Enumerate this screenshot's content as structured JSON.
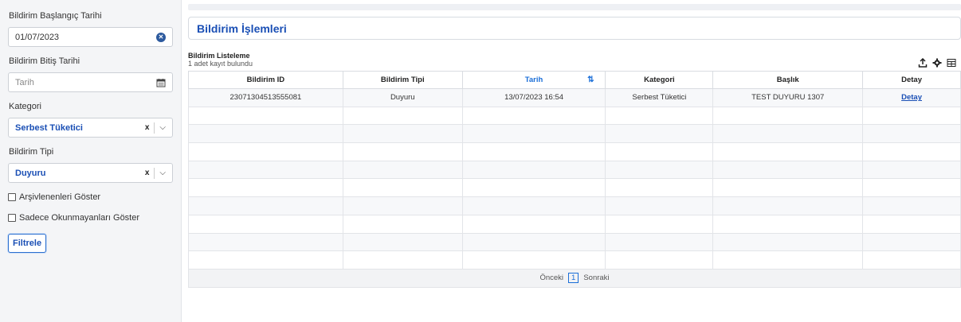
{
  "filters": {
    "start_date_label": "Bildirim Başlangıç Tarihi",
    "start_date_value": "01/07/2023",
    "end_date_label": "Bildirim Bitiş Tarihi",
    "end_date_placeholder": "Tarih",
    "category_label": "Kategori",
    "category_value": "Serbest Tüketici",
    "type_label": "Bildirim Tipi",
    "type_value": "Duyuru",
    "clear_glyph": "x",
    "show_archived_label": "Arşivlenenleri Göster",
    "show_unread_label": "Sadece Okunmayanları Göster",
    "filter_button": "Filtrele"
  },
  "page": {
    "title": "Bildirim İşlemleri"
  },
  "list": {
    "title": "Bildirim Listeleme",
    "count_text": "1 adet kayıt bulundu",
    "columns": [
      "Bildirim ID",
      "Bildirim Tipi",
      "Tarih",
      "Kategori",
      "Başlık",
      "Detay"
    ],
    "sorted_column": "Tarih",
    "rows": [
      {
        "id": "23071304513555081",
        "type": "Duyuru",
        "date": "13/07/2023 16:54",
        "category": "Serbest Tüketici",
        "title": "TEST DUYURU 1307",
        "detail": "Detay"
      }
    ],
    "empty_rows": 9
  },
  "pager": {
    "prev": "Önceki",
    "current": "1",
    "next": "Sonraki"
  },
  "icons": {
    "export": "upload-icon",
    "settings": "gear-icon",
    "columns": "columns-icon",
    "calendar": "calendar-icon",
    "clear": "clear-circle-icon",
    "chevron": "chevron-down-icon",
    "sort": "sort-icon"
  },
  "colors": {
    "accent": "#1a4fb5",
    "active_header": "#1a6ed8",
    "sidebar_bg": "#f4f5f7"
  }
}
